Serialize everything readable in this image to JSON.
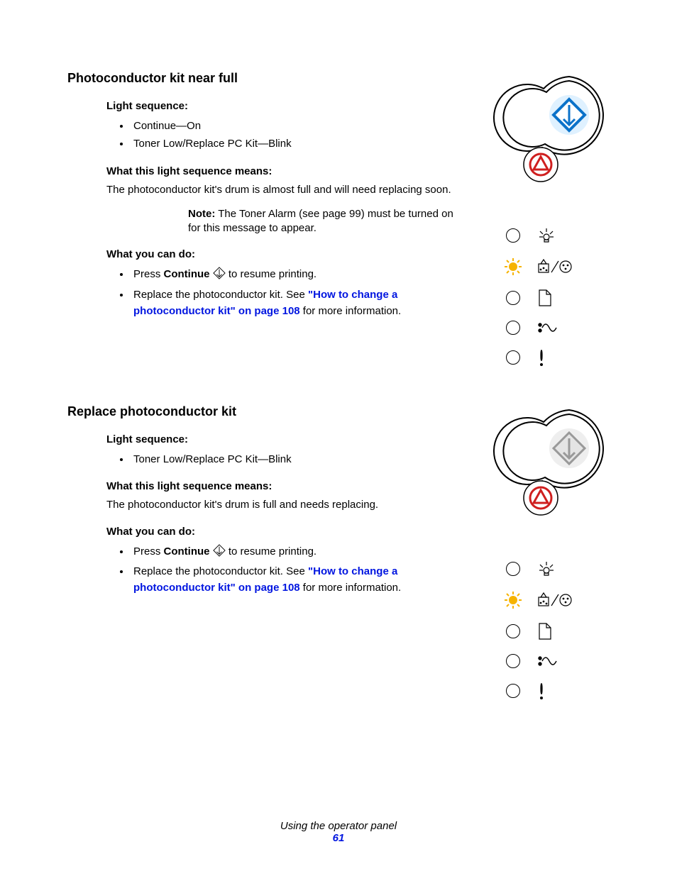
{
  "section1": {
    "title": "Photoconductor kit near full",
    "h_seq": "Light sequence:",
    "seq_items": [
      "Continue—On",
      "Toner Low/Replace PC Kit—Blink"
    ],
    "h_mean": "What this light sequence means:",
    "mean_text": "The photoconductor kit's drum is almost full and will need replacing soon.",
    "note_label": "Note:",
    "note_text": " The Toner Alarm (see page 99) must be turned on for this message to appear.",
    "h_do": "What you can do:",
    "do1_a": "Press ",
    "do1_b": "Continue",
    "do1_c": "  to resume printing.",
    "do2_a": "Replace the photoconductor kit. See ",
    "do2_link": "\"How to change a photoconductor kit\" on page 108",
    "do2_b": " for more information."
  },
  "section2": {
    "title": "Replace photoconductor kit",
    "h_seq": "Light sequence:",
    "seq_items": [
      "Toner Low/Replace PC Kit—Blink"
    ],
    "h_mean": "What this light sequence means:",
    "mean_text": "The photoconductor kit's drum is full and needs replacing.",
    "h_do": "What you can do:",
    "do1_a": "Press ",
    "do1_b": "Continue",
    "do1_c": "  to resume printing.",
    "do2_a": "Replace the photoconductor kit. See ",
    "do2_link": "\"How to change a photoconductor kit\" on page 108",
    "do2_b": " for more information."
  },
  "footer": {
    "title": "Using the operator panel",
    "page": "61"
  }
}
